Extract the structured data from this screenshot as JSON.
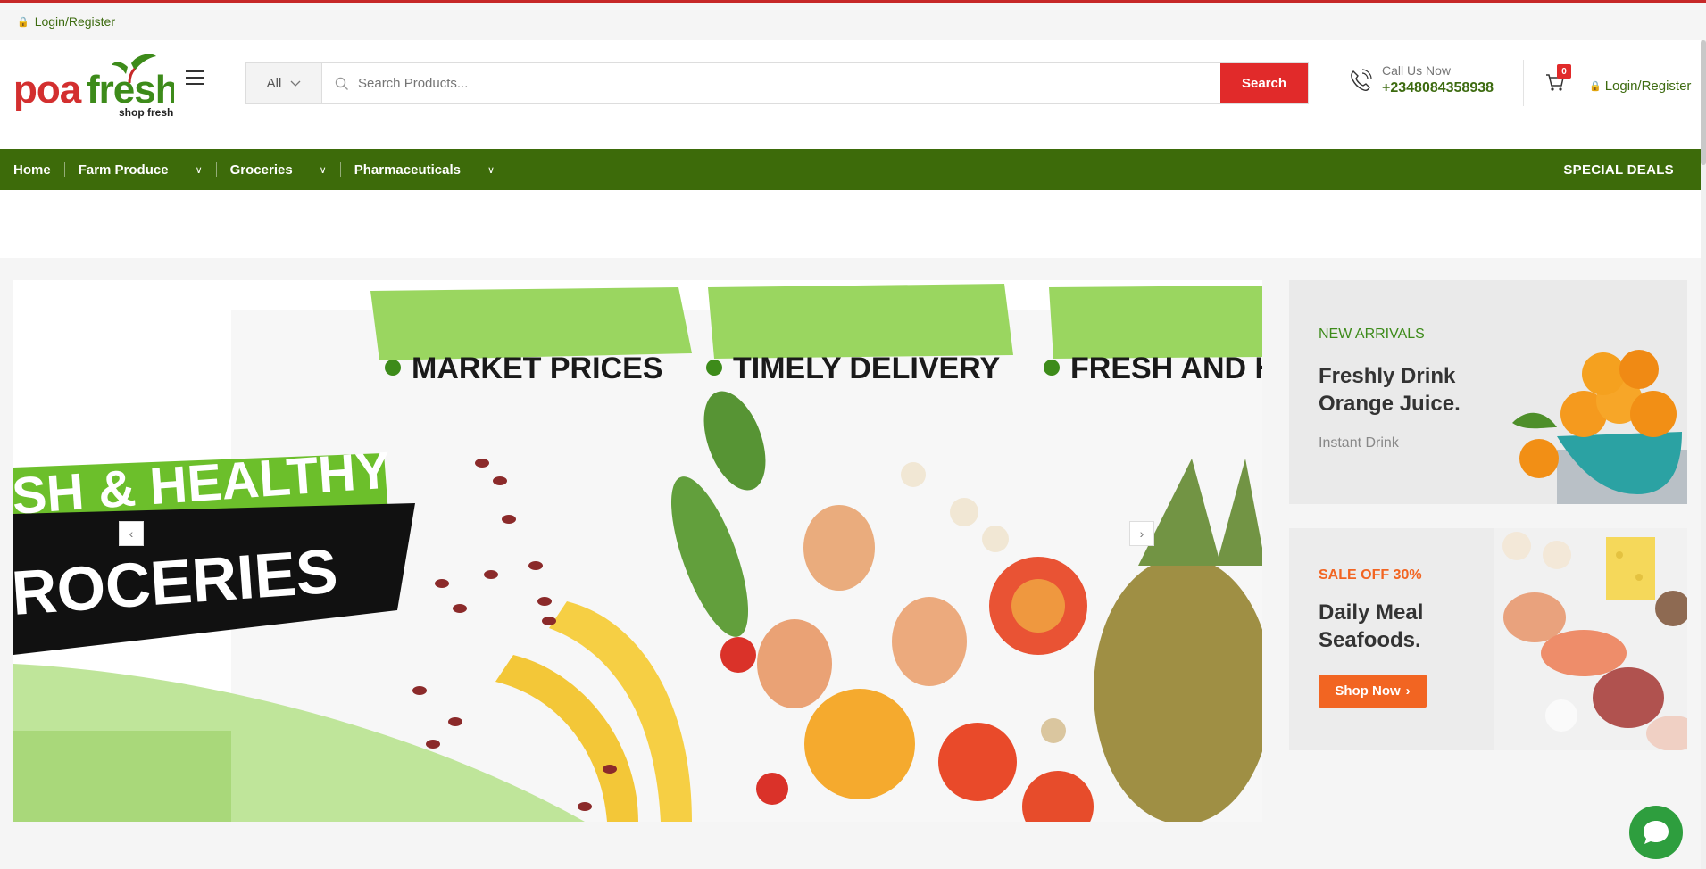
{
  "topbar": {
    "login_label": "Login/Register"
  },
  "header": {
    "logo_text": "poafresh",
    "logo_tagline": "shop fresh",
    "search": {
      "category_label": "All",
      "placeholder": "Search Products...",
      "button_label": "Search"
    },
    "call_label": "Call Us Now",
    "phone": "+2348084358938",
    "cart_count": "0",
    "login_label": "Login/Register"
  },
  "nav": {
    "items": [
      {
        "label": "Home"
      },
      {
        "label": "Farm Produce"
      },
      {
        "label": "Groceries"
      },
      {
        "label": "Pharmaceuticals"
      }
    ],
    "special_label": "SPECIAL DEALS"
  },
  "hero": {
    "features": [
      "MARKET PRICES",
      "TIMELY DELIVERY",
      "FRESH AND H"
    ],
    "headline_line1": "SH & HEALTHY",
    "headline_line2": "ROCERIES"
  },
  "banners": [
    {
      "tag": "NEW ARRIVALS",
      "title_line1": "Freshly Drink",
      "title_line2": "Orange Juice.",
      "subtitle": "Instant Drink"
    },
    {
      "tag": "SALE OFF 30%",
      "title_line1": "Daily Meal",
      "title_line2": "Seafoods.",
      "button_label": "Shop Now"
    }
  ],
  "colors": {
    "brand_green": "#3d6b0a",
    "accent_red": "#e12a2a",
    "sale_orange": "#f26522"
  }
}
